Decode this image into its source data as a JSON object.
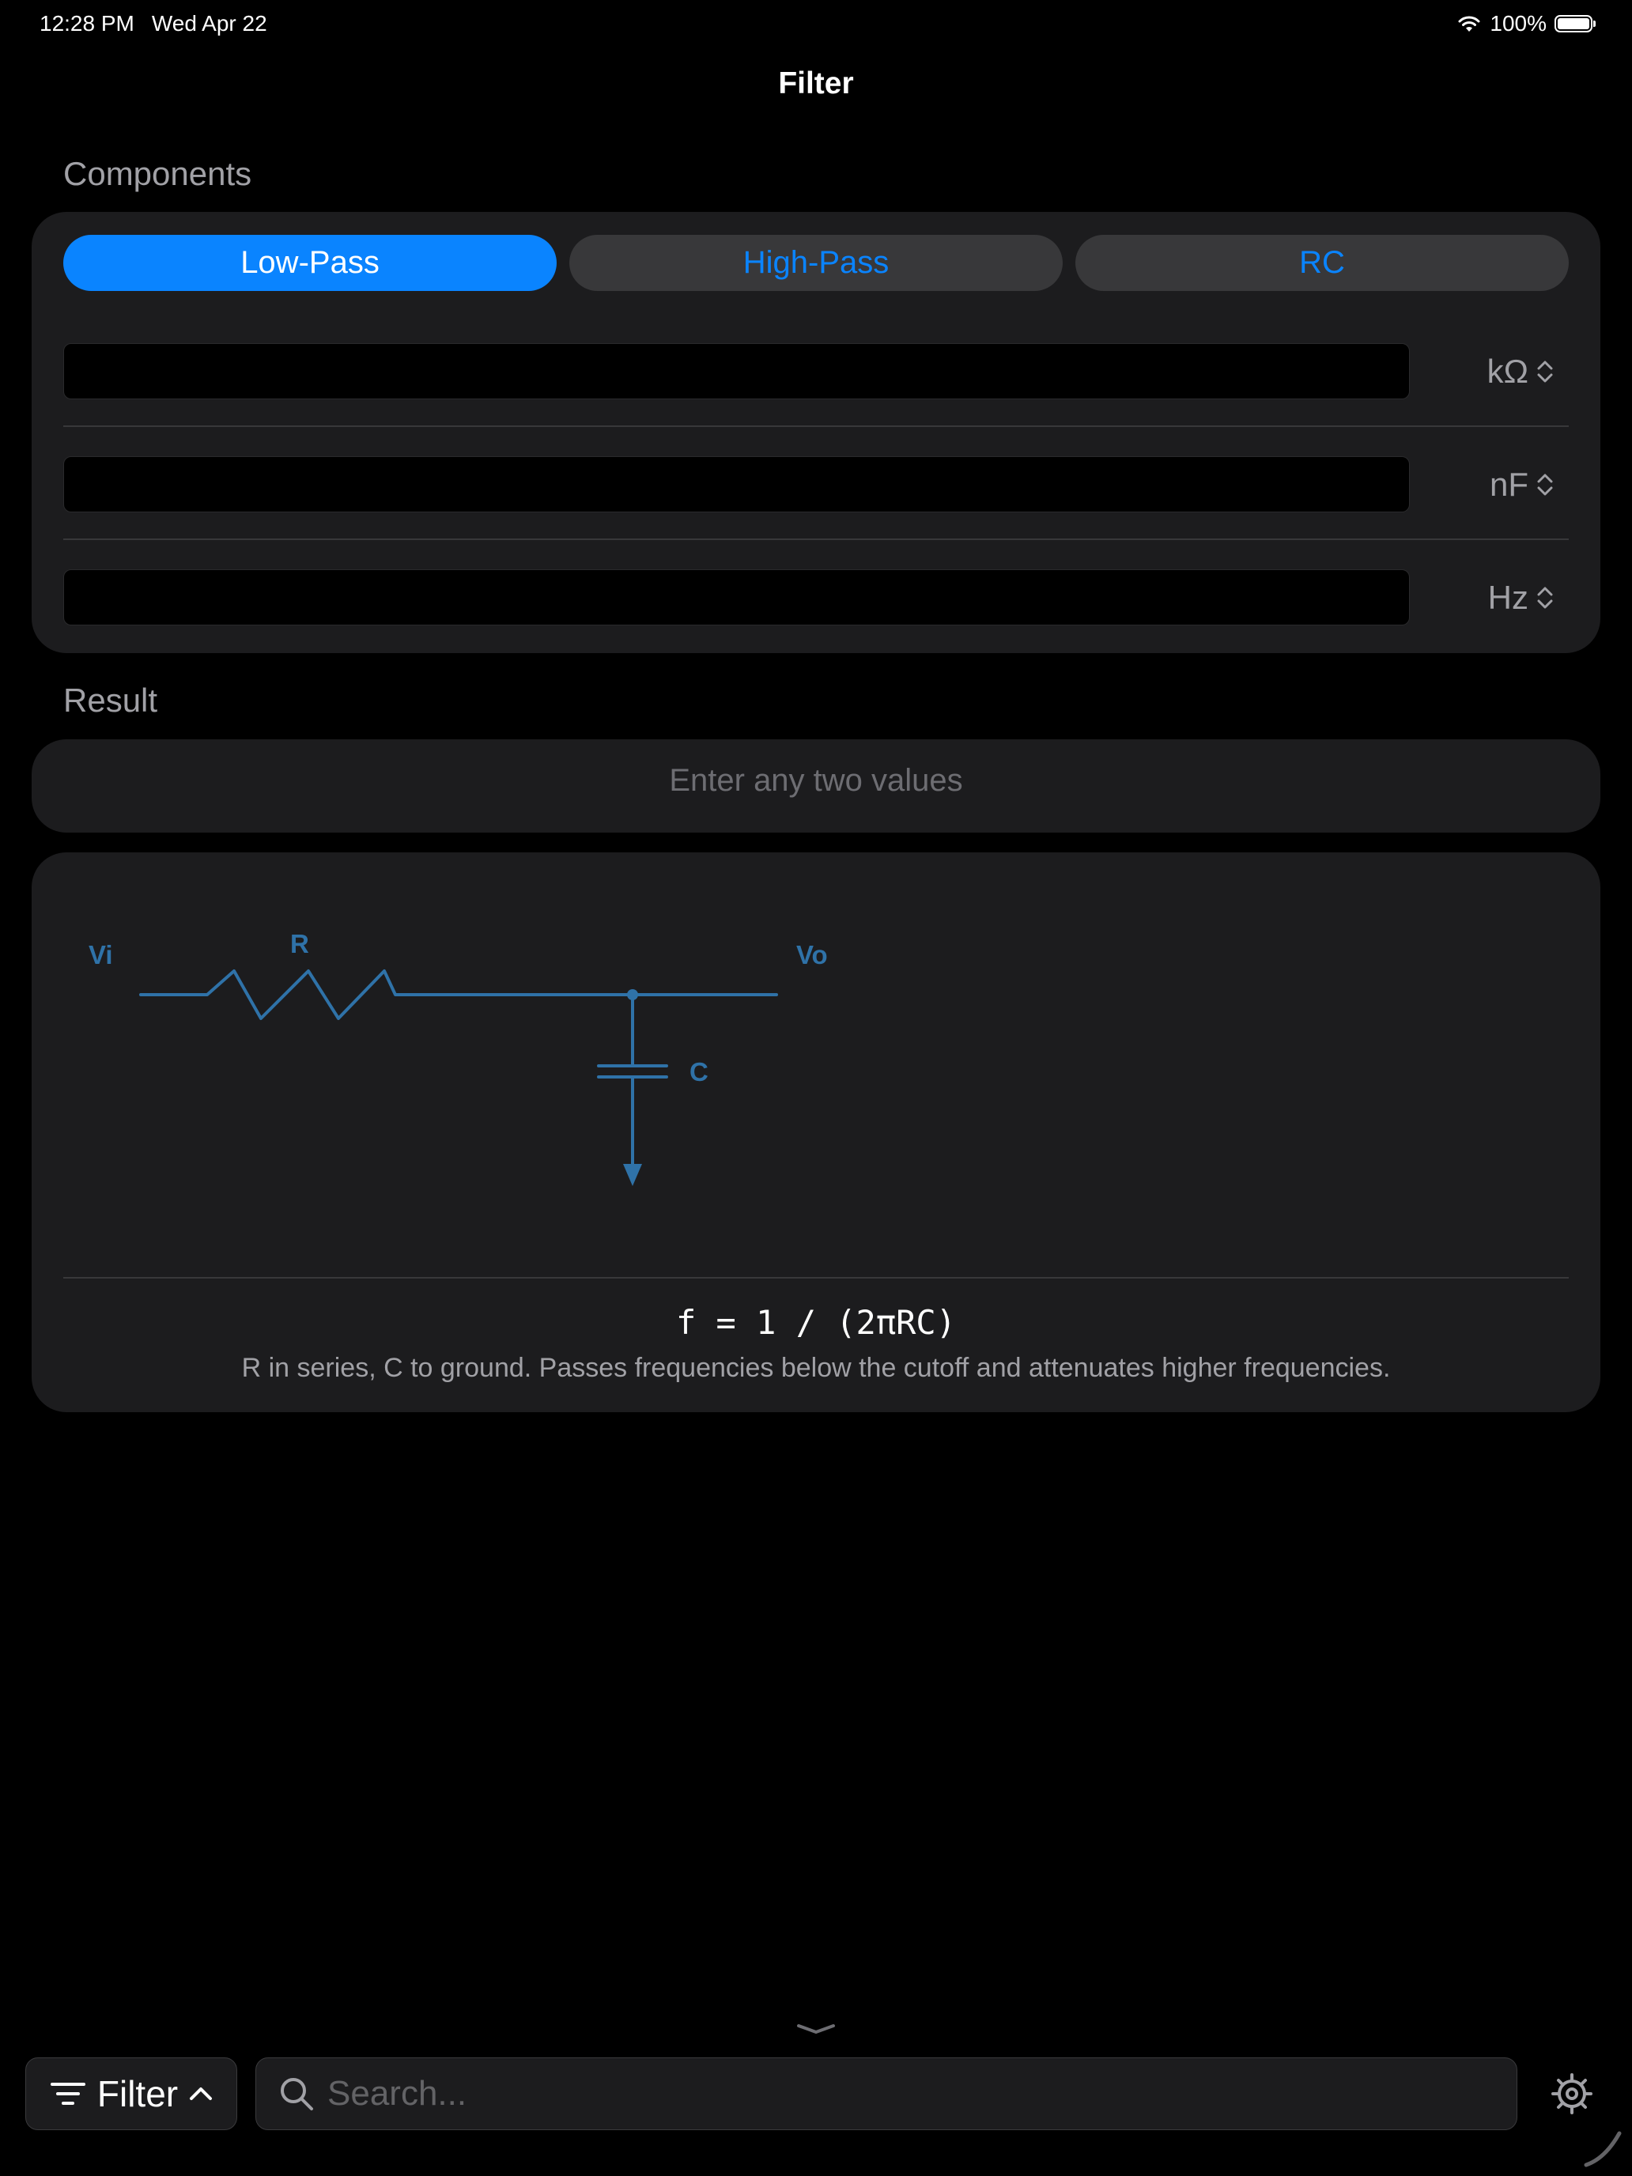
{
  "status_bar": {
    "time": "12:28 PM",
    "date": "Wed Apr 22",
    "battery": "100%"
  },
  "nav": {
    "title": "Filter"
  },
  "components": {
    "label": "Components",
    "tabs": [
      {
        "label": "Low-Pass",
        "selected": true
      },
      {
        "label": "High-Pass",
        "selected": false
      },
      {
        "label": "RC",
        "selected": false
      }
    ],
    "fields": [
      {
        "value": "",
        "unit": "kΩ"
      },
      {
        "value": "",
        "unit": "nF"
      },
      {
        "value": "",
        "unit": "Hz"
      }
    ]
  },
  "result": {
    "label": "Result",
    "text": "Enter any two values"
  },
  "diagram": {
    "input_label": "Vi",
    "output_label": "Vo",
    "resistor_label": "R",
    "capacitor_label": "C",
    "color": "#2f72a8"
  },
  "formula": "f = 1 / (2πRC)",
  "description": "R in series, C to ground. Passes frequencies below the cutoff and attenuates higher frequencies.",
  "toolbar": {
    "filter_label": "Filter",
    "search_placeholder": "Search...",
    "icons": [
      "filter-lines-icon",
      "chevron-up-icon",
      "search-icon",
      "gear-icon"
    ]
  },
  "colors": {
    "accent": "#0a84ff",
    "card": "#1c1c1e",
    "background": "#000000"
  }
}
